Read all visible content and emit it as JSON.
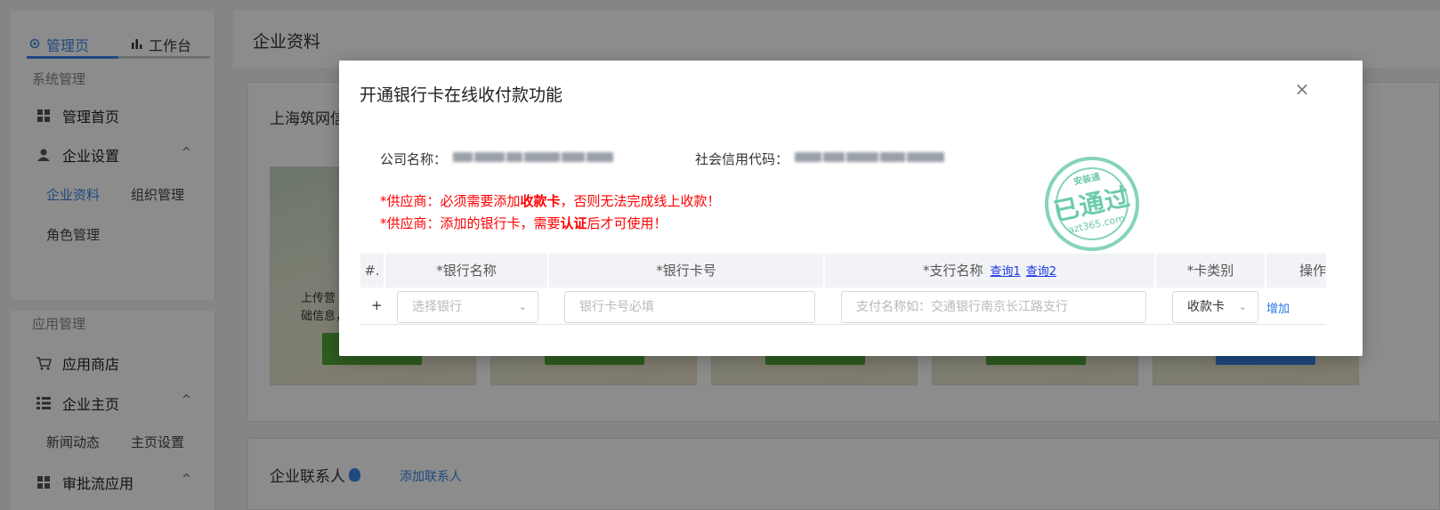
{
  "sidebar": {
    "tabs": [
      {
        "label": "管理页",
        "icon": "gear-icon",
        "active": true
      },
      {
        "label": "工作台",
        "icon": "bar-chart-icon",
        "active": false
      }
    ],
    "sections": [
      {
        "title": "系统管理",
        "items": [
          {
            "label": "管理首页",
            "icon": "grid-icon"
          },
          {
            "label": "企业设置",
            "icon": "user-icon",
            "expanded": true,
            "children": [
              {
                "label": "企业资料",
                "active": true
              },
              {
                "label": "组织管理"
              },
              {
                "label": "角色管理"
              }
            ]
          }
        ]
      },
      {
        "title": "应用管理",
        "items": [
          {
            "label": "应用商店",
            "icon": "cart-icon"
          },
          {
            "label": "企业主页",
            "icon": "list-icon",
            "expanded": true,
            "children": [
              {
                "label": "新闻动态"
              },
              {
                "label": "主页设置"
              }
            ]
          },
          {
            "label": "审批流应用",
            "icon": "grid-icon",
            "expanded": true
          }
        ]
      }
    ],
    "caret": "^"
  },
  "main": {
    "title": "企业资料",
    "card1": {
      "title": "上海筑网信",
      "tile_text_1": "上传营",
      "tile_text_2": "础信息，"
    },
    "card2": {
      "title": "企业联系人",
      "link": "添加联系人"
    }
  },
  "modal": {
    "title": "开通银行卡在线收付款功能",
    "close": "×",
    "company_label": "公司名称：",
    "credit_label": "社会信用代码：",
    "warning1": {
      "prefix": "*供应商：必须需要添加",
      "bold": "收款卡",
      "suffix": "，否则无法完成线上收款！"
    },
    "warning2": {
      "prefix": "*供应商：添加的银行卡，需要",
      "bold": "认证",
      "suffix": "后才可使用！"
    },
    "table": {
      "headers": {
        "index": "#.",
        "bank_name": "*银行名称",
        "card_no": "*银行卡号",
        "branch": "*支行名称",
        "query1": "查询1",
        "query2": "查询2",
        "card_type": "*卡类别",
        "action": "操作"
      },
      "row": {
        "plus": "+",
        "bank_placeholder": "选择银行",
        "card_placeholder": "银行卡号必填",
        "branch_placeholder": "支付名称如：交通银行南京长江路支行",
        "card_type_value": "收款卡",
        "add": "增加"
      }
    }
  },
  "watermark": {
    "top": "安装通",
    "middle": "已通过",
    "bottom": "azt365.com",
    "color": "#6ecdaa"
  },
  "colors": {
    "accent": "#3a86e8",
    "warning": "#ff0000",
    "tile_green": "#52a83a",
    "tile_blue": "#3a86e8"
  }
}
